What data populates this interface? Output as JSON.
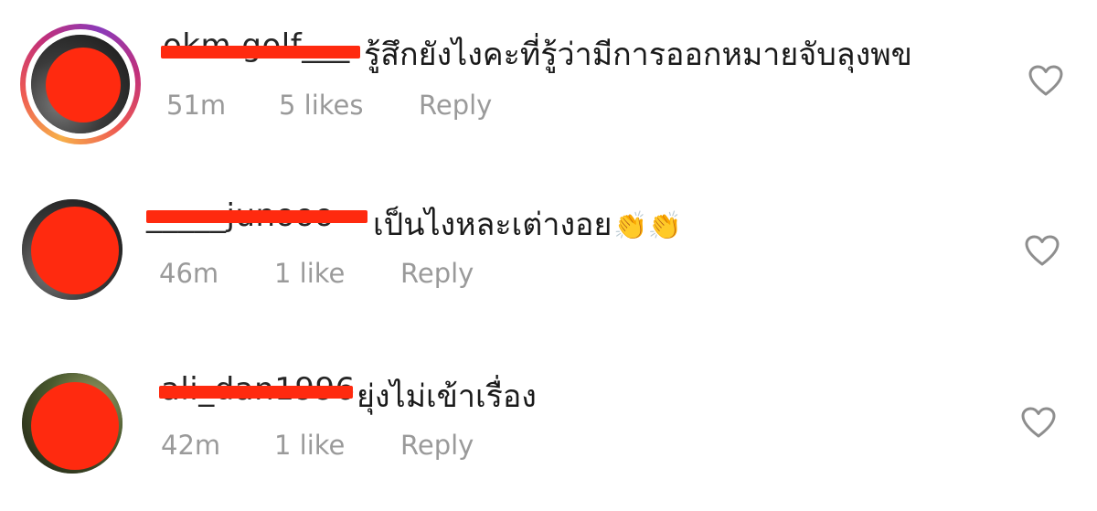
{
  "comments": [
    {
      "username": "okm.golf___",
      "text": "รู้สึกยังไงคะที่รู้ว่ามีการออกหมายจับลุงพข",
      "emoji": "",
      "time": "51m",
      "likes": "5 likes",
      "reply_label": "Reply",
      "has_story_ring": true
    },
    {
      "username": "_____junooo",
      "text": "เป็นไงหละเต่างอย",
      "emoji": "👏👏",
      "time": "46m",
      "likes": "1 like",
      "reply_label": "Reply",
      "has_story_ring": false
    },
    {
      "username": "ali_dan1996",
      "text": "ยุ่งไม่เข้าเรื่อง",
      "emoji": "",
      "time": "42m",
      "likes": "1 like",
      "reply_label": "Reply",
      "has_story_ring": false
    }
  ],
  "icons": {
    "like": "heart-outline-icon"
  },
  "colors": {
    "redaction": "#ff2a0f",
    "meta_text": "#9a9a9a",
    "heart_stroke": "#8e8e8e"
  }
}
